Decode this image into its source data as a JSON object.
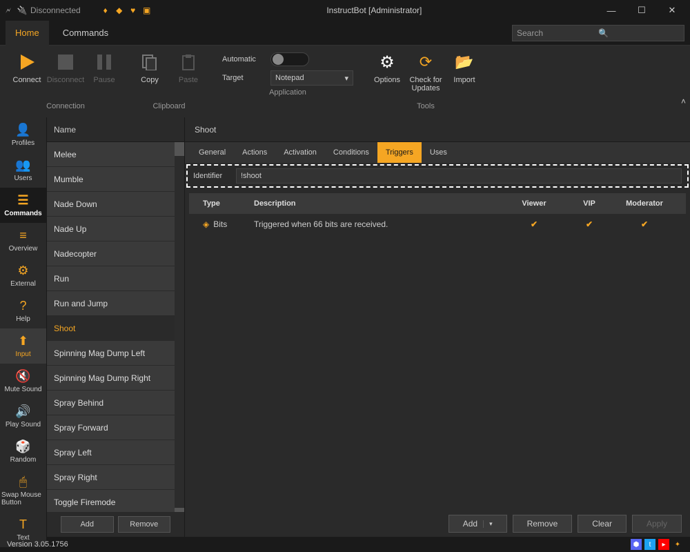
{
  "titlebar": {
    "status": "Disconnected",
    "title": "InstructBot [Administrator]"
  },
  "menu": {
    "tabs": [
      "Home",
      "Commands"
    ],
    "active": 0,
    "search_placeholder": "Search"
  },
  "ribbon": {
    "connection": {
      "label": "Connection",
      "connect": "Connect",
      "disconnect": "Disconnect",
      "pause": "Pause"
    },
    "clipboard": {
      "label": "Clipboard",
      "copy": "Copy",
      "paste": "Paste"
    },
    "application": {
      "label": "Application",
      "automatic": "Automatic",
      "target": "Target",
      "target_value": "Notepad"
    },
    "tools": {
      "label": "Tools",
      "options": "Options",
      "check": "Check for\nUpdates",
      "import": "Import"
    }
  },
  "nav": {
    "items": [
      {
        "label": "Profiles"
      },
      {
        "label": "Users"
      },
      {
        "label": "Commands",
        "active": true
      },
      {
        "label": "Overview"
      },
      {
        "label": "External"
      },
      {
        "label": "Help"
      },
      {
        "label": "Input",
        "selected": true
      },
      {
        "label": "Mute Sound"
      },
      {
        "label": "Play Sound"
      },
      {
        "label": "Random"
      },
      {
        "label": "Swap Mouse Button"
      },
      {
        "label": "Text"
      }
    ]
  },
  "list": {
    "header": "Name",
    "items": [
      "Melee",
      "Mumble",
      "Nade Down",
      "Nade Up",
      "Nadecopter",
      "Run",
      "Run and Jump",
      "Shoot",
      "Spinning Mag Dump Left",
      "Spinning Mag Dump Right",
      "Spray Behind",
      "Spray Forward",
      "Spray Left",
      "Spray Right",
      "Toggle Firemode"
    ],
    "selected": "Shoot",
    "add": "Add",
    "remove": "Remove"
  },
  "detail": {
    "title": "Shoot",
    "tabs": [
      "General",
      "Actions",
      "Activation",
      "Conditions",
      "Triggers",
      "Uses"
    ],
    "active_tab": 4,
    "identifier_label": "Identifier",
    "identifier_value": "!shoot",
    "columns": {
      "type": "Type",
      "desc": "Description",
      "viewer": "Viewer",
      "vip": "VIP",
      "mod": "Moderator"
    },
    "rows": [
      {
        "type": "Bits",
        "desc": "Triggered when 66 bits are received.",
        "viewer": true,
        "vip": true,
        "mod": true
      }
    ],
    "buttons": {
      "add": "Add",
      "remove": "Remove",
      "clear": "Clear",
      "apply": "Apply"
    }
  },
  "status": {
    "version": "Version 3.05.1756"
  }
}
